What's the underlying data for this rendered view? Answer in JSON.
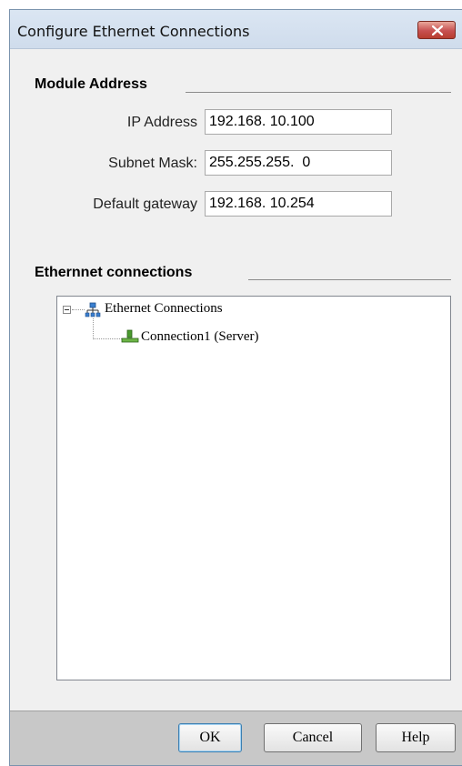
{
  "window": {
    "title": "Configure Ethernet Connections"
  },
  "module_address": {
    "group_title": "Module Address",
    "ip_address": {
      "label": "IP Address",
      "value": "192.168. 10.100"
    },
    "subnet_mask": {
      "label": "Subnet Mask:",
      "value": "255.255.255.  0"
    },
    "default_gateway": {
      "label": "Default gateway",
      "value": "192.168. 10.254"
    }
  },
  "connections": {
    "group_title": "Ethernnet connections",
    "tree": {
      "root": {
        "label": "Ethernet Connections",
        "icon": "network-icon",
        "expanded": true
      },
      "children": [
        {
          "label": "Connection1 (Server)",
          "icon": "connection-icon"
        }
      ]
    }
  },
  "buttons": {
    "ok": "OK",
    "cancel": "Cancel",
    "help": "Help"
  },
  "colors": {
    "close_button": "#c75050",
    "titlebar": "#d6e1ef",
    "footer": "#c8c8c8"
  }
}
